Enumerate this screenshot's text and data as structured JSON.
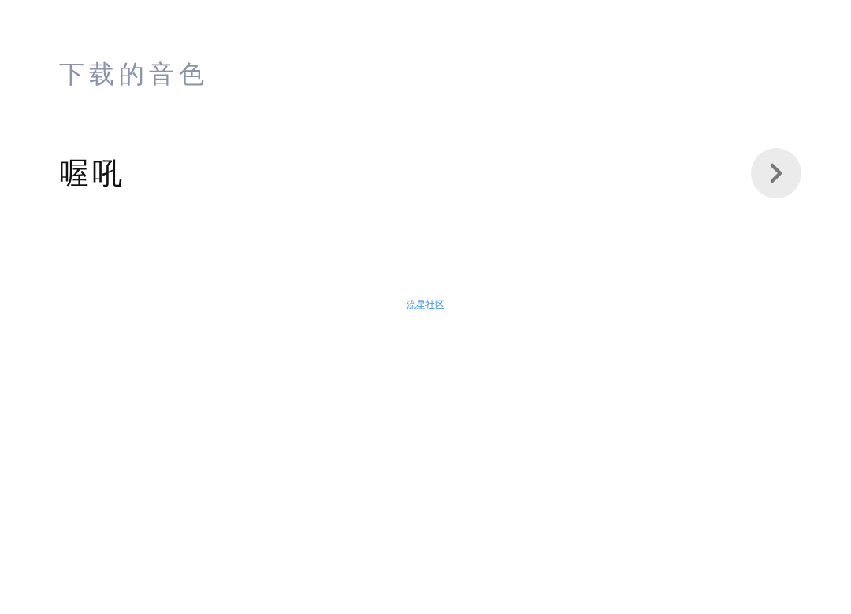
{
  "title": "下载的音色",
  "voices": [
    {
      "name": "喔吼"
    }
  ],
  "footer_link": "流星社区"
}
